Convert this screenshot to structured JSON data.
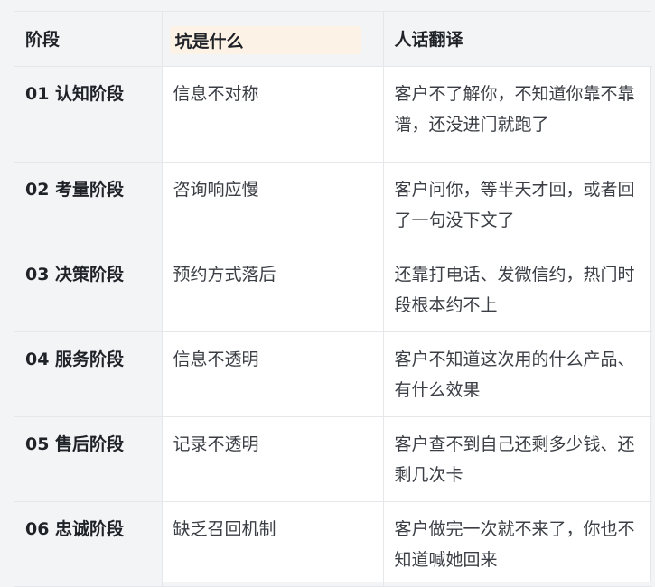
{
  "table": {
    "headers": [
      "阶段",
      "坑是什么",
      "人话翻译"
    ],
    "rows": [
      {
        "stage": "01 认知阶段",
        "pitfall": "信息不对称",
        "translation": "客户不了解你，不知道你靠不靠谱，还没进门就跑了"
      },
      {
        "stage": "02 考量阶段",
        "pitfall": "咨询响应慢",
        "translation": "客户问你，等半天才回，或者回了一句没下文了"
      },
      {
        "stage": "03 决策阶段",
        "pitfall": "预约方式落后",
        "translation": "还靠打电话、发微信约，热门时段根本约不上"
      },
      {
        "stage": "04 服务阶段",
        "pitfall": "信息不透明",
        "translation": "客户不知道这次用的什么产品、有什么效果"
      },
      {
        "stage": "05 售后阶段",
        "pitfall": "记录不透明",
        "translation": "客户查不到自己还剩多少钱、还剩几次卡"
      },
      {
        "stage": "06 忠诚阶段",
        "pitfall": "缺乏召回机制",
        "translation": "客户做完一次就不来了，你也不知道喊她回来"
      }
    ]
  }
}
